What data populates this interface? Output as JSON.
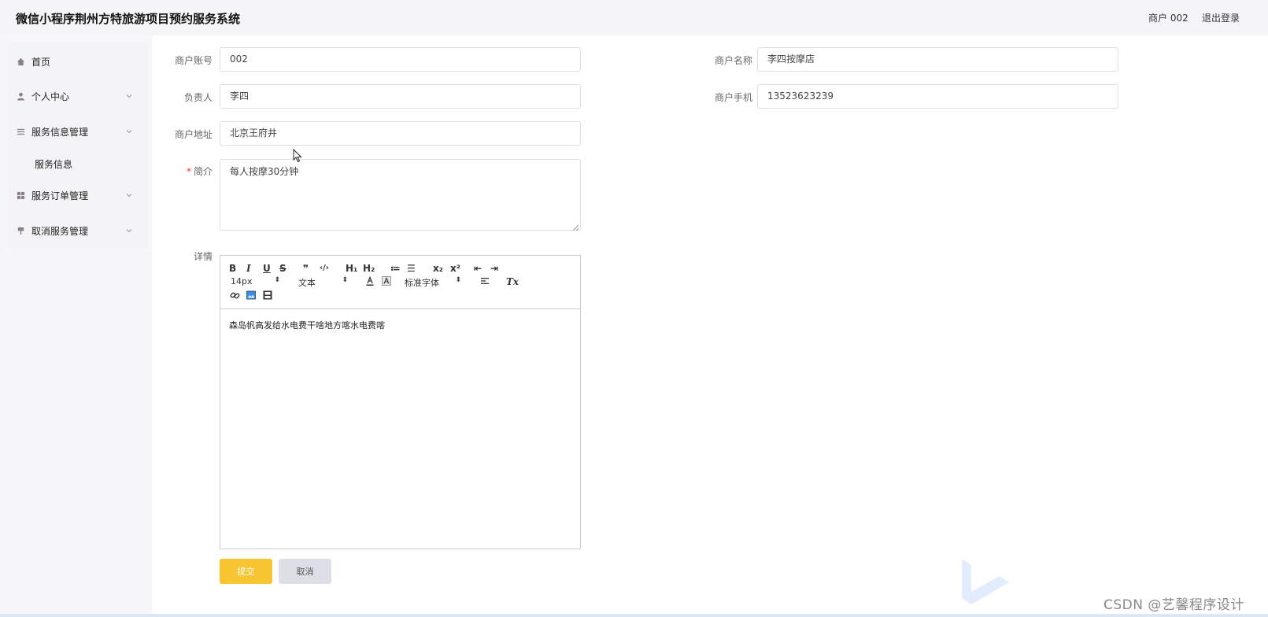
{
  "header": {
    "title": "微信小程序荆州方特旅游项目预约服务系统",
    "user": "商户 002",
    "logout": "退出登录"
  },
  "sidebar": {
    "items": [
      {
        "label": "首页",
        "icon": "home-icon"
      },
      {
        "label": "个人中心",
        "icon": "user-icon"
      },
      {
        "label": "服务信息管理",
        "icon": "list-icon"
      },
      {
        "label": "服务订单管理",
        "icon": "grid-icon"
      },
      {
        "label": "取消服务管理",
        "icon": "pin-icon"
      }
    ],
    "sub_items": [
      {
        "label": "服务信息"
      }
    ]
  },
  "form": {
    "account_label": "商户账号",
    "account_value": "002",
    "name_label": "商户名称",
    "name_value": "李四按摩店",
    "owner_label": "负责人",
    "owner_value": "李四",
    "phone_label": "商户手机",
    "phone_value": "13523623239",
    "address_label": "商户地址",
    "address_value": "北京王府井",
    "intro_required": "*",
    "intro_label": "简介",
    "intro_value": "每人按摩30分钟",
    "detail_label": "详情"
  },
  "editor": {
    "bold": "B",
    "italic": "I",
    "underline": "U",
    "strike": "S",
    "quote": "❞",
    "code": "‹/›",
    "h1": "H₁",
    "h2": "H₂",
    "ordered_list": "≔",
    "bullet_list": "☰",
    "subscript": "x₂",
    "superscript": "x²",
    "outdent": "⇤",
    "indent": "⇥",
    "font_size": "14px",
    "header_select": "文本",
    "font_family": "标准字体",
    "clean": "Tx",
    "content": "森岛帆高发给水电费干啥地方喀水电费喀"
  },
  "buttons": {
    "submit": "提交",
    "cancel": "取消"
  },
  "watermark": "CSDN @艺馨程序设计",
  "colors": {
    "accent": "#f7c531",
    "cancel": "#dcdfe6",
    "required": "#ee3333"
  }
}
